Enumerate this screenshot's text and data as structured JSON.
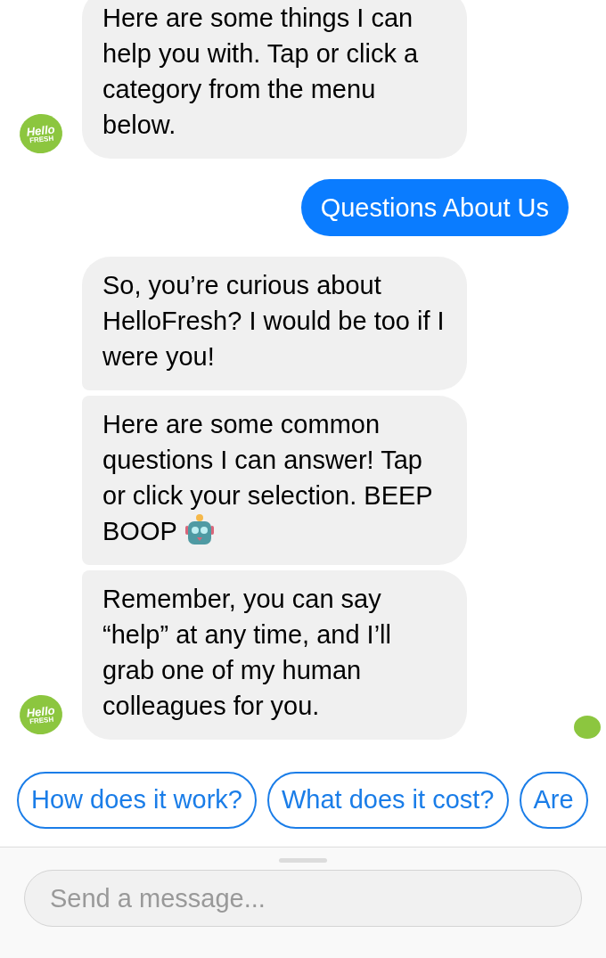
{
  "messages": [
    {
      "kind": "received",
      "bubbles": [
        {
          "kind": "plain",
          "text": "Here are some things I can help you with. Tap or click a category from the menu below."
        }
      ],
      "avatar": {
        "line_1": "Hello",
        "line_2": "FRESH"
      }
    },
    {
      "kind": "sent",
      "bubbles": [
        {
          "text": "Questions About Us"
        }
      ]
    },
    {
      "kind": "received",
      "bubbles": [
        {
          "kind": "plain",
          "text": "So, you’re curious about HelloFresh? I would be too if I were you!"
        },
        {
          "kind": "with_robot",
          "text": "Here are some common questions I can answer! Tap or click your selection. BEEP BOOP"
        },
        {
          "kind": "plain",
          "text": "Remember, you can say “help” at any time, and I’ll grab one of my human colleagues for you."
        }
      ],
      "avatar": {
        "line_1": "Hello",
        "line_2": "FRESH"
      },
      "read_receipt": true
    }
  ],
  "quick_replies": [
    "How does it work?",
    "What does it cost?",
    "Are"
  ],
  "composer": {
    "placeholder": "Send a message..."
  }
}
